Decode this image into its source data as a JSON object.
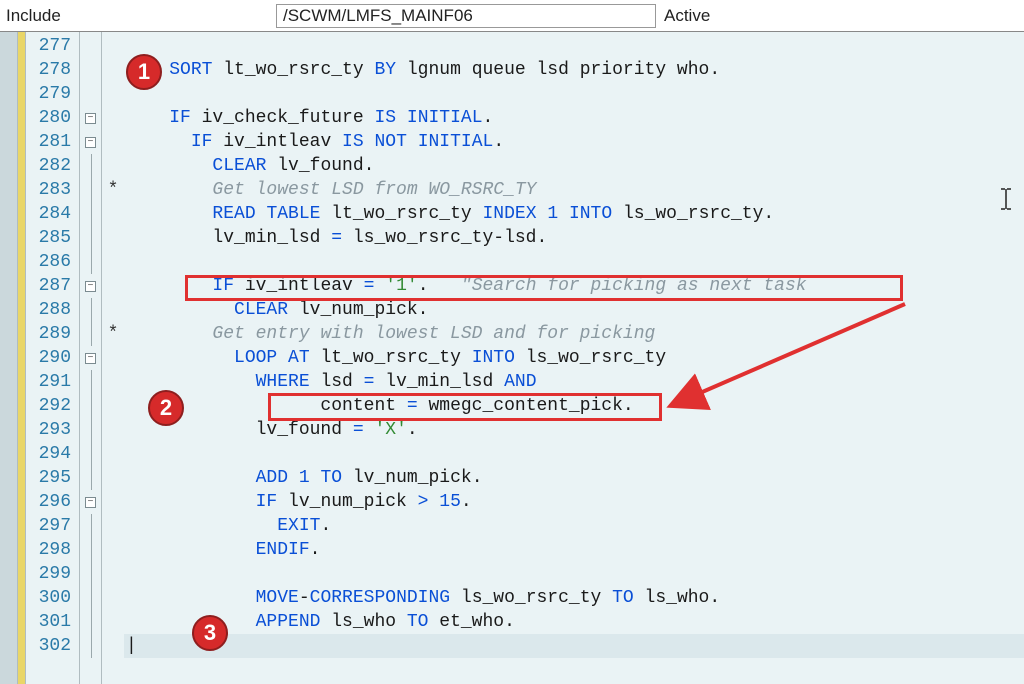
{
  "header": {
    "label": "Include",
    "path": "/SCWM/LMFS_MAINF06",
    "status": "Active"
  },
  "lines": {
    "start": 277,
    "end": 302
  },
  "fold": {
    "280": "minus",
    "281": "minus",
    "287": "minus",
    "290": "minus",
    "296": "minus"
  },
  "stars": {
    "283": "*",
    "289": "*"
  },
  "code": {
    "277": "",
    "278": "    <kw>SORT</kw> lt_wo_rsrc_ty <kw>BY</kw> lgnum queue lsd priority who.",
    "279": "",
    "280": "    <kw>IF</kw> iv_check_future <kw>IS</kw> <kw>INITIAL</kw>.",
    "281": "      <kw>IF</kw> iv_intleav <kw>IS</kw> <kw>NOT</kw> <kw>INITIAL</kw>.",
    "282": "        <kw>CLEAR</kw> lv_found.",
    "283": "        <cm>Get lowest LSD from WO_RSRC_TY</cm>",
    "284": "        <kw>READ</kw> <kw>TABLE</kw> lt_wo_rsrc_ty <kw>INDEX</kw> <num>1</num> <kw>INTO</kw> ls_wo_rsrc_ty.",
    "285": "        lv_min_lsd <kw>=</kw> ls_wo_rsrc_ty-lsd.",
    "286": "",
    "287": "        <kw>IF</kw> iv_intleav <kw>=</kw> <str>'1'</str>.   <cm>\"Search for picking as next task</cm>",
    "288": "          <kw>CLEAR</kw> lv_num_pick.",
    "289": "        <cm>Get entry with lowest LSD and for picking</cm>",
    "290": "          <kw>LOOP AT</kw> lt_wo_rsrc_ty <kw>INTO</kw> ls_wo_rsrc_ty",
    "291": "            <kw>WHERE</kw> lsd <kw>=</kw> lv_min_lsd <kw>AND</kw>",
    "292": "                  content <kw>=</kw> wmegc_content_pick.",
    "293": "            lv_found <kw>=</kw> <str>'X'</str>.",
    "294": "",
    "295": "            <kw>ADD</kw> <num>1</num> <kw>TO</kw> lv_num_pick.",
    "296": "            <kw>IF</kw> lv_num_pick <kw>&gt;</kw> <num>15</num>.",
    "297": "              <kw>EXIT</kw>.",
    "298": "            <kw>ENDIF</kw>.",
    "299": "",
    "300": "            <kw>MOVE</kw>-<kw>CORRESPONDING</kw> ls_wo_rsrc_ty <kw>TO</kw> ls_who.",
    "301": "            <kw>APPEND</kw> ls_who <kw>TO</kw> et_who.",
    "302": "|"
  },
  "badges": {
    "1": "1",
    "2": "2",
    "3": "3"
  },
  "current_line": 302
}
